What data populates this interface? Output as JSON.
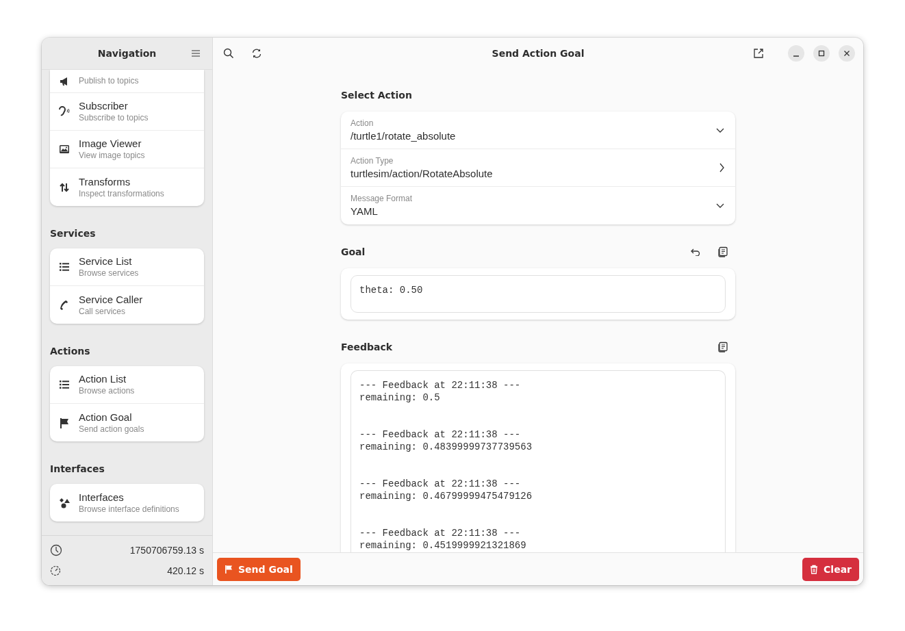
{
  "sidebar": {
    "title": "Navigation",
    "groups": [
      {
        "items": [
          {
            "subtitle": "Publish to topics"
          },
          {
            "title": "Subscriber",
            "subtitle": "Subscribe to topics"
          },
          {
            "title": "Image Viewer",
            "subtitle": "View image topics"
          },
          {
            "title": "Transforms",
            "subtitle": "Inspect transformations"
          }
        ]
      },
      {
        "heading": "Services",
        "items": [
          {
            "title": "Service List",
            "subtitle": "Browse services"
          },
          {
            "title": "Service Caller",
            "subtitle": "Call services"
          }
        ]
      },
      {
        "heading": "Actions",
        "items": [
          {
            "title": "Action List",
            "subtitle": "Browse actions"
          },
          {
            "title": "Action Goal",
            "subtitle": "Send action goals"
          }
        ]
      },
      {
        "heading": "Interfaces",
        "items": [
          {
            "title": "Interfaces",
            "subtitle": "Browse interface definitions"
          }
        ]
      }
    ],
    "footer": [
      {
        "value": "1750706759.13 s"
      },
      {
        "value": "420.12 s"
      }
    ]
  },
  "main": {
    "title": "Send Action Goal",
    "select_action": {
      "heading": "Select Action",
      "rows": [
        {
          "label": "Action",
          "value": "/turtle1/rotate_absolute",
          "kind": "dropdown"
        },
        {
          "label": "Action Type",
          "value": "turtlesim/action/RotateAbsolute",
          "kind": "link"
        },
        {
          "label": "Message Format",
          "value": "YAML",
          "kind": "dropdown"
        }
      ]
    },
    "goal": {
      "heading": "Goal",
      "value": "theta: 0.50"
    },
    "feedback": {
      "heading": "Feedback",
      "text": "--- Feedback at 22:11:38 ---\nremaining: 0.5\n\n\n--- Feedback at 22:11:38 ---\nremaining: 0.48399999737739563\n\n\n--- Feedback at 22:11:38 ---\nremaining: 0.46799999475479126\n\n\n--- Feedback at 22:11:38 ---\nremaining: 0.4519999921321869"
    }
  },
  "buttons": [
    {
      "label": "Send Goal",
      "kind": "send"
    },
    {
      "label": "Clear",
      "kind": "clear"
    }
  ]
}
